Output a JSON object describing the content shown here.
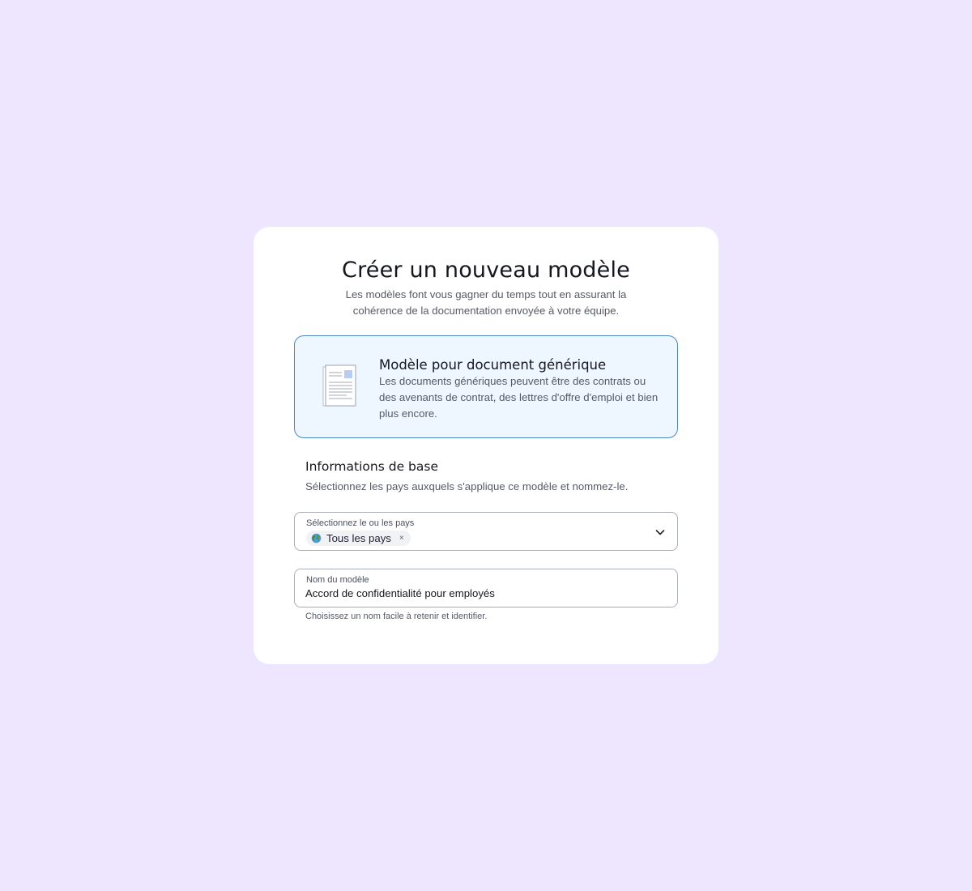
{
  "dialog": {
    "title": "Créer un nouveau modèle",
    "subtitle": "Les modèles font vous gagner du temps tout en assurant la cohérence de la documentation envoyée à votre équipe."
  },
  "template_option": {
    "icon": "document-icon",
    "title": "Modèle pour document générique",
    "description": "Les documents génériques peuvent être des contrats ou des avenants de contrat, des lettres d'offre d'emploi et bien plus encore."
  },
  "basic_info": {
    "title": "Informations de base",
    "description": "Sélectionnez les pays auxquels s'applique ce modèle et nommez-le."
  },
  "country_field": {
    "label": "Sélectionnez le ou les pays",
    "chip_icon": "globe-icon",
    "chip_label": "Tous les pays",
    "chip_close": "×",
    "dropdown_icon": "chevron-down-icon"
  },
  "name_field": {
    "label": "Nom du modèle",
    "value": "Accord de confidentialité pour employés",
    "helper": "Choisissez un nom facile à retenir et identifier."
  },
  "colors": {
    "background": "#ede6fe",
    "card": "#ffffff",
    "option_background": "#eef6ff",
    "option_border": "#4e86c2"
  }
}
